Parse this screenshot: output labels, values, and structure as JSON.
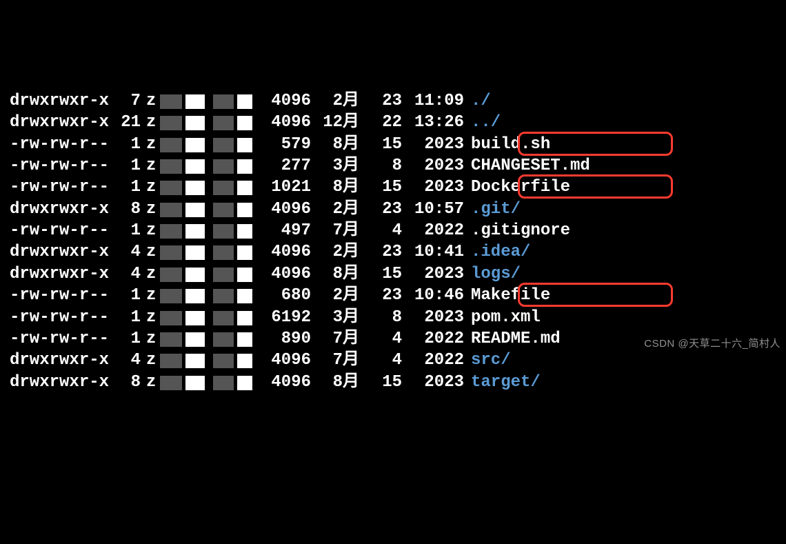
{
  "rows": [
    {
      "perms": "drwxrwxr-x",
      "links": "7",
      "owner": "z",
      "size": "4096",
      "month": "2月",
      "day": "23",
      "time": "11:09",
      "name": "./",
      "is_dir": true,
      "highlighted": false
    },
    {
      "perms": "drwxrwxr-x",
      "links": "21",
      "owner": "z",
      "size": "4096",
      "month": "12月",
      "day": "22",
      "time": "13:26",
      "name": "../",
      "is_dir": true,
      "highlighted": false
    },
    {
      "perms": "-rw-rw-r--",
      "links": "1",
      "owner": "z",
      "size": "579",
      "month": "8月",
      "day": "15",
      "time": "2023",
      "name": "build.sh",
      "is_dir": false,
      "highlighted": true
    },
    {
      "perms": "-rw-rw-r--",
      "links": "1",
      "owner": "z",
      "size": "277",
      "month": "3月",
      "day": "8",
      "time": "2023",
      "name": "CHANGESET.md",
      "is_dir": false,
      "highlighted": false
    },
    {
      "perms": "-rw-rw-r--",
      "links": "1",
      "owner": "z",
      "size": "1021",
      "month": "8月",
      "day": "15",
      "time": "2023",
      "name": "Dockerfile",
      "is_dir": false,
      "highlighted": true
    },
    {
      "perms": "drwxrwxr-x",
      "links": "8",
      "owner": "z",
      "size": "4096",
      "month": "2月",
      "day": "23",
      "time": "10:57",
      "name": ".git/",
      "is_dir": true,
      "highlighted": false
    },
    {
      "perms": "-rw-rw-r--",
      "links": "1",
      "owner": "z",
      "size": "497",
      "month": "7月",
      "day": "4",
      "time": "2022",
      "name": ".gitignore",
      "is_dir": false,
      "highlighted": false
    },
    {
      "perms": "drwxrwxr-x",
      "links": "4",
      "owner": "z",
      "size": "4096",
      "month": "2月",
      "day": "23",
      "time": "10:41",
      "name": ".idea/",
      "is_dir": true,
      "highlighted": false
    },
    {
      "perms": "drwxrwxr-x",
      "links": "4",
      "owner": "z",
      "size": "4096",
      "month": "8月",
      "day": "15",
      "time": "2023",
      "name": "logs/",
      "is_dir": true,
      "highlighted": false
    },
    {
      "perms": "-rw-rw-r--",
      "links": "1",
      "owner": "z",
      "size": "680",
      "month": "2月",
      "day": "23",
      "time": "10:46",
      "name": "Makefile",
      "is_dir": false,
      "highlighted": true
    },
    {
      "perms": "-rw-rw-r--",
      "links": "1",
      "owner": "z",
      "size": "6192",
      "month": "3月",
      "day": "8",
      "time": "2023",
      "name": "pom.xml",
      "is_dir": false,
      "highlighted": false
    },
    {
      "perms": "-rw-rw-r--",
      "links": "1",
      "owner": "z",
      "size": "890",
      "month": "7月",
      "day": "4",
      "time": "2022",
      "name": "README.md",
      "is_dir": false,
      "highlighted": false
    },
    {
      "perms": "drwxrwxr-x",
      "links": "4",
      "owner": "z",
      "size": "4096",
      "month": "7月",
      "day": "4",
      "time": "2022",
      "name": "src/",
      "is_dir": true,
      "highlighted": false
    },
    {
      "perms": "drwxrwxr-x",
      "links": "8",
      "owner": "z",
      "size": "4096",
      "month": "8月",
      "day": "15",
      "time": "2023",
      "name": "target/",
      "is_dir": true,
      "highlighted": false
    }
  ],
  "watermark": "CSDN @天草二十六_简村人"
}
